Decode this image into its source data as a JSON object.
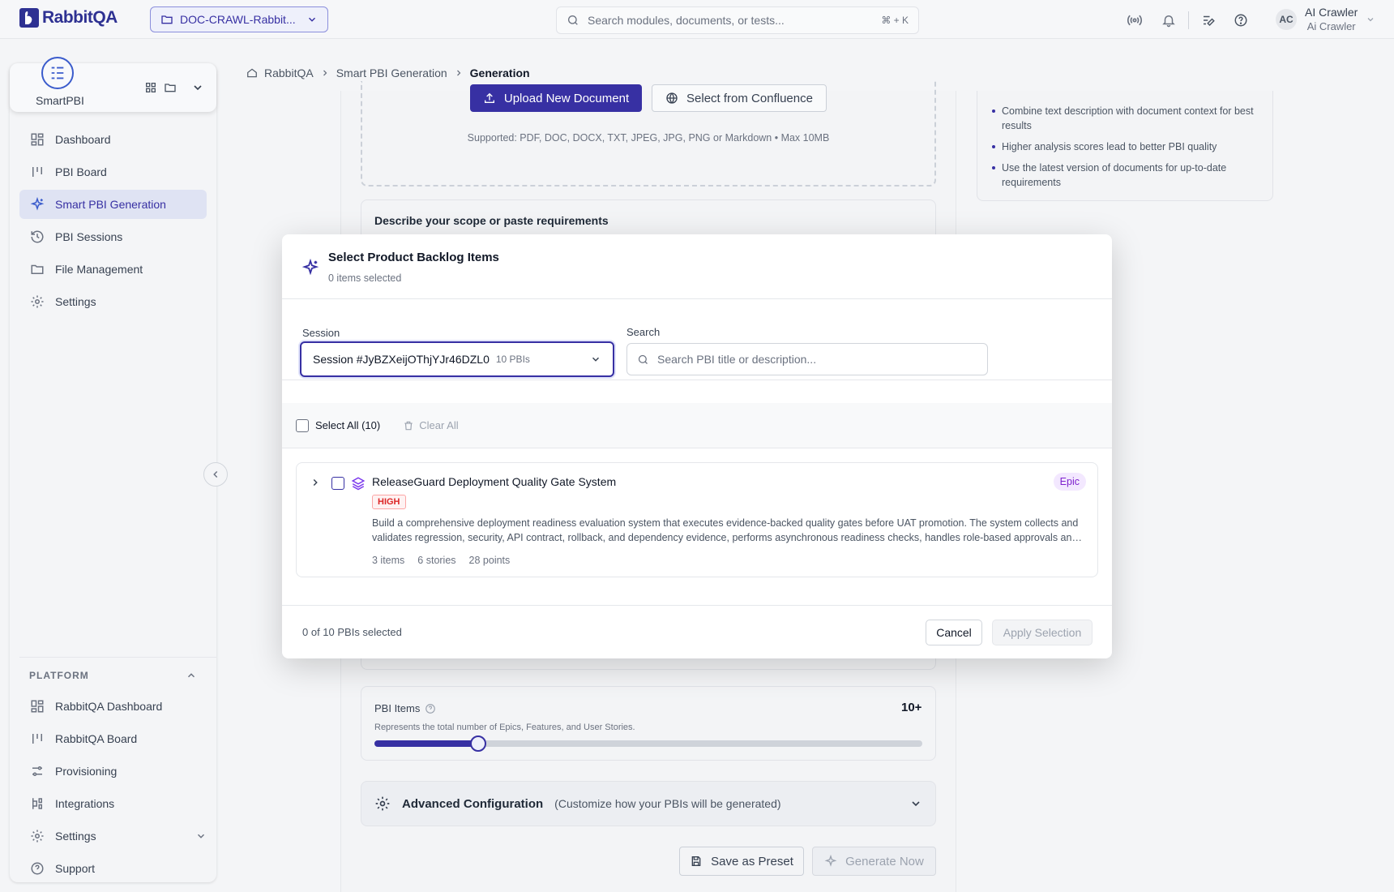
{
  "app": {
    "logo_text": "RabbitQA",
    "project": "DOC-CRAWL-Rabbit...",
    "search_placeholder": "Search modules, documents, or tests...",
    "search_shortcut": "⌘ + K",
    "user": {
      "initials": "AC",
      "name": "AI Crawler",
      "subtitle": "Ai Crawler"
    },
    "brand_color": "#3730a3"
  },
  "sidebar": {
    "app_name": "SmartPBI",
    "items": [
      {
        "label": "Dashboard",
        "icon": "dashboard-icon"
      },
      {
        "label": "PBI Board",
        "icon": "board-icon"
      },
      {
        "label": "Smart PBI Generation",
        "icon": "sparkle-icon",
        "active": true
      },
      {
        "label": "PBI Sessions",
        "icon": "history-icon"
      },
      {
        "label": "File Management",
        "icon": "folder-icon"
      },
      {
        "label": "Settings",
        "icon": "gear-icon"
      }
    ],
    "platform": {
      "header": "PLATFORM",
      "items": [
        {
          "label": "RabbitQA Dashboard",
          "icon": "dashboard-icon"
        },
        {
          "label": "RabbitQA Board",
          "icon": "board-icon"
        },
        {
          "label": "Provisioning",
          "icon": "sliders-icon"
        },
        {
          "label": "Integrations",
          "icon": "integration-icon"
        },
        {
          "label": "Settings",
          "icon": "gear-icon"
        },
        {
          "label": "Support",
          "icon": "help-icon"
        }
      ]
    }
  },
  "breadcrumb": {
    "home": "RabbitQA",
    "parent": "Smart PBI Generation",
    "current": "Generation"
  },
  "main": {
    "upload_button": "Upload New Document",
    "confluence_button": "Select from Confluence",
    "supported": "Supported: PDF, DOC, DOCX, TXT, JPEG, JPG, PNG or Markdown • Max 10MB",
    "scope_title": "Describe your scope or paste requirements",
    "pbi_items": {
      "label": "PBI Items",
      "value_label": "10+",
      "description": "Represents the total number of Epics, Features, and User Stories.",
      "slider_fraction": 0.19
    },
    "advanced": {
      "title": "Advanced Configuration",
      "subtitle": "(Customize how your PBIs will be generated)"
    },
    "save_preset": "Save as Preset",
    "generate": "Generate Now",
    "tips": [
      "Combine text description with document context for best results",
      "Higher analysis scores lead to better PBI quality",
      "Use the latest version of documents for up-to-date requirements"
    ]
  },
  "modal": {
    "title": "Select Product Backlog Items",
    "selected_count": "0 items selected",
    "session_label": "Session",
    "session_value": "Session #JyBZXeijOThjYJr46DZL0",
    "session_pbis": "10 PBIs",
    "search_label": "Search",
    "search_placeholder": "Search PBI title or description...",
    "select_all": "Select All (10)",
    "clear_all": "Clear All",
    "items": [
      {
        "title": "ReleaseGuard Deployment Quality Gate System",
        "priority": "HIGH",
        "type": "Epic",
        "description": "Build a comprehensive deployment readiness evaluation system that executes evidence-backed quality gates before UAT promotion. The system collects and validates regression, security, API contract, rollback, and dependency evidence, performs asynchronous readiness checks, handles role-based approvals and reporting.",
        "items": "3 items",
        "stories": "6 stories",
        "points": "28 points"
      }
    ],
    "footer_count": "0 of 10 PBIs selected",
    "cancel": "Cancel",
    "apply": "Apply Selection"
  }
}
